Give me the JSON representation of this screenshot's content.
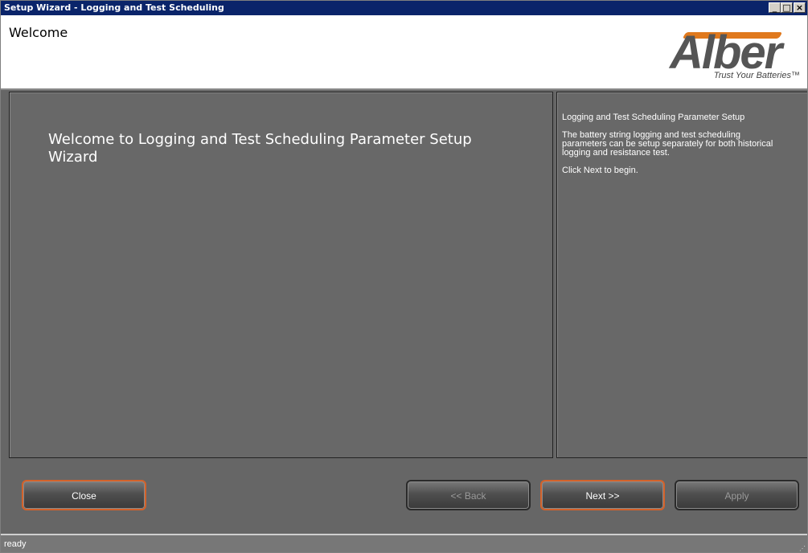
{
  "window": {
    "title": "Setup Wizard - Logging and Test Scheduling",
    "controls": {
      "minimize": "_",
      "maximize": "□",
      "close": "×"
    }
  },
  "header": {
    "title": "Welcome",
    "logo": {
      "brand": "Alber",
      "tagline": "Trust Your Batteries™",
      "accent_color": "#e0791d"
    }
  },
  "main": {
    "welcome_text": "Welcome to Logging and Test Scheduling Parameter Setup Wizard"
  },
  "info_panel": {
    "heading": "Logging and Test Scheduling Parameter Setup",
    "description": "The battery string logging and test scheduling parameters can be setup separately for both historical logging and resistance test.",
    "instruction": "Click Next to begin."
  },
  "buttons": {
    "close": "Close",
    "back": "<< Back",
    "next": "Next >>",
    "apply": "Apply"
  },
  "status": {
    "text": "ready"
  },
  "colors": {
    "panel_bg": "#686868",
    "button_active_border": "#d4622a",
    "title_bar": "#0a246a"
  }
}
